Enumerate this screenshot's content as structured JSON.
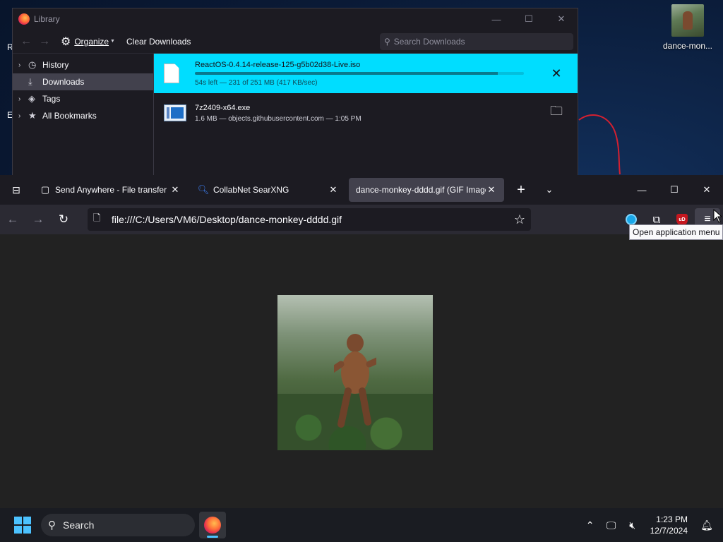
{
  "desktop": {
    "icon_label": "dance-mon...",
    "edge_text_1": "R",
    "edge_text_2": "E"
  },
  "library": {
    "title": "Library",
    "organize_label": "Organize",
    "clear_label": "Clear Downloads",
    "search_placeholder": "Search Downloads",
    "sidebar": [
      {
        "label": "History",
        "icon": "clock-icon",
        "twisty": "›"
      },
      {
        "label": "Downloads",
        "icon": "download-icon",
        "twisty": ""
      },
      {
        "label": "Tags",
        "icon": "tag-icon",
        "twisty": "›"
      },
      {
        "label": "All Bookmarks",
        "icon": "star-icon",
        "twisty": "›"
      }
    ],
    "downloads": [
      {
        "name": "ReactOS-0.4.14-release-125-g5b02d38-Live.iso",
        "status": "54s left — 231 of 251 MB (417 KB/sec)",
        "progress": 0.92
      },
      {
        "name": "7z2409-x64.exe",
        "status": "1.6 MB — objects.githubusercontent.com — 1:05 PM"
      }
    ]
  },
  "browser": {
    "tabs": [
      {
        "label": "Send Anywhere - File transfer",
        "favicon": "send-anywhere-icon"
      },
      {
        "label": "CollabNet SearXNG",
        "favicon": "search-icon"
      },
      {
        "label": "dance-monkey-dddd.gif (GIF Image",
        "favicon": ""
      }
    ],
    "url": "file:///C:/Users/VM6/Desktop/dance-monkey-dddd.gif",
    "tooltip": "Open application menu",
    "ublock_label": "uD"
  },
  "taskbar": {
    "search_label": "Search",
    "time": "1:23 PM",
    "date": "12/7/2024"
  },
  "colors": {
    "active_download": "#00ddff",
    "start_blue": "#4cc2ff"
  }
}
